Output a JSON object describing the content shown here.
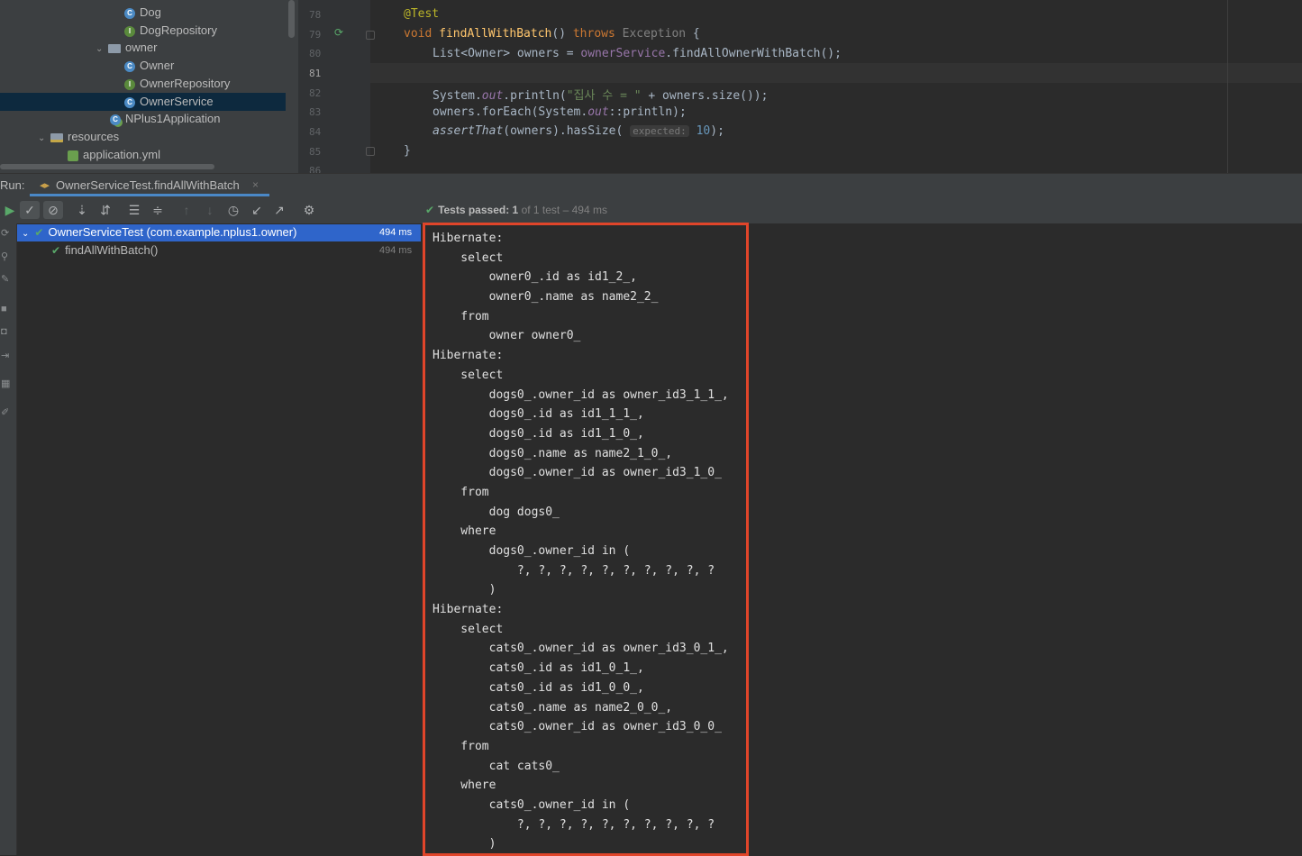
{
  "project_tree": {
    "items": [
      {
        "label": "Dog",
        "icon": "class-icon"
      },
      {
        "label": "DogRepository",
        "icon": "interface-icon"
      },
      {
        "label": "owner",
        "icon": "package-icon"
      },
      {
        "label": "Owner",
        "icon": "class-icon"
      },
      {
        "label": "OwnerRepository",
        "icon": "interface-icon"
      },
      {
        "label": "OwnerService",
        "icon": "class-icon",
        "selected": true
      },
      {
        "label": "NPlus1Application",
        "icon": "spring-app-icon"
      },
      {
        "label": "resources",
        "icon": "resources-folder-icon"
      },
      {
        "label": "application.yml",
        "icon": "yaml-icon"
      }
    ]
  },
  "editor": {
    "line_numbers": [
      "78",
      "79",
      "80",
      "81",
      "82",
      "83",
      "84",
      "85",
      "86"
    ],
    "current_line": "81",
    "lines": {
      "l78_annotation": "@Test",
      "l79_void": "void ",
      "l79_method": "findAllWithBatch",
      "l79_parens": "() ",
      "l79_throws": "throws",
      "l79_exception": " Exception",
      "l79_brace": " {",
      "l80_type": "List<Owner> owners = ",
      "l80_service": "ownerService",
      "l80_call": ".findAllOwnerWithBatch();",
      "l82_prefix": "System.",
      "l82_out": "out",
      "l82_println": ".println(",
      "l82_string": "\"집사 수 = \"",
      "l82_suffix": " + owners.size());",
      "l83_prefix": "owners.forEach(System.",
      "l83_out": "out",
      "l83_suffix": "::println);",
      "l84_assert": "assertThat",
      "l84_mid": "(owners).hasSize( ",
      "l84_hint": "expected:",
      "l84_num": " 10",
      "l84_end": ");",
      "l85_brace": "}"
    }
  },
  "run_panel": {
    "label": "Run:",
    "tab_title": "OwnerServiceTest.findAllWithBatch",
    "status_prefix": "Tests passed: ",
    "status_count": "1",
    "status_suffix": " of 1 test – 494 ms",
    "test_root": {
      "label": "OwnerServiceTest (com.example.nplus1.owner)",
      "time": "494 ms"
    },
    "test_child": {
      "label": "findAllWithBatch()",
      "time": "494 ms"
    }
  },
  "console": {
    "lines": [
      "Hibernate: ",
      "    select",
      "        owner0_.id as id1_2_,",
      "        owner0_.name as name2_2_ ",
      "    from",
      "        owner owner0_",
      "Hibernate: ",
      "    select",
      "        dogs0_.owner_id as owner_id3_1_1_,",
      "        dogs0_.id as id1_1_1_,",
      "        dogs0_.id as id1_1_0_,",
      "        dogs0_.name as name2_1_0_,",
      "        dogs0_.owner_id as owner_id3_1_0_ ",
      "    from",
      "        dog dogs0_ ",
      "    where",
      "        dogs0_.owner_id in (",
      "            ?, ?, ?, ?, ?, ?, ?, ?, ?, ?",
      "        )",
      "Hibernate: ",
      "    select",
      "        cats0_.owner_id as owner_id3_0_1_,",
      "        cats0_.id as id1_0_1_,",
      "        cats0_.id as id1_0_0_,",
      "        cats0_.name as name2_0_0_,",
      "        cats0_.owner_id as owner_id3_0_0_ ",
      "    from",
      "        cat cats0_ ",
      "    where",
      "        cats0_.owner_id in (",
      "            ?, ?, ?, ?, ?, ?, ?, ?, ?, ?",
      "        )"
    ]
  },
  "colors": {
    "highlight_border": "#e0452a",
    "selection": "#2f65ca",
    "pass_green": "#59a869"
  }
}
